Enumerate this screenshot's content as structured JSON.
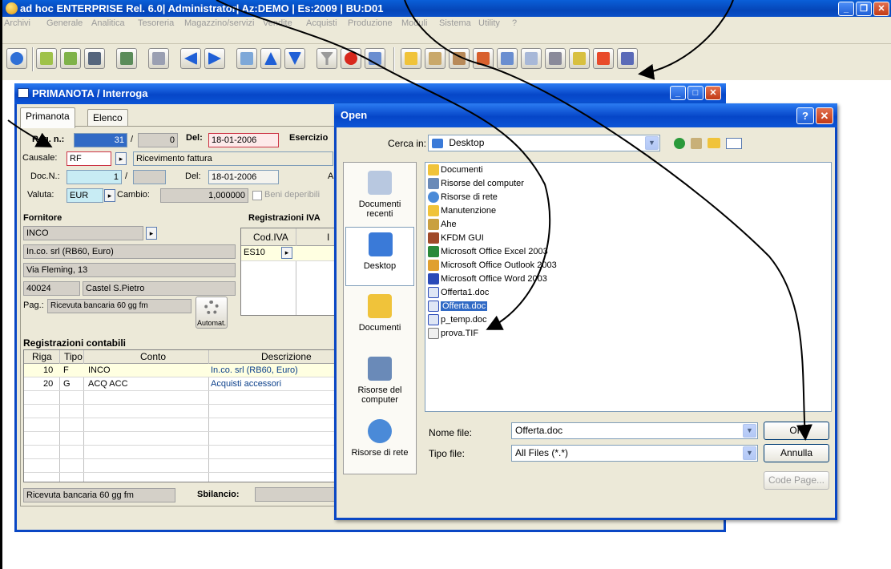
{
  "app": {
    "title": "ad hoc ENTERPRISE Rel. 6.0| Administrator| Az:DEMO | Es:2009 | BU:D01"
  },
  "menu": [
    "Archivi",
    "Generale",
    "Analitica",
    "Tesoreria",
    "Magazzino/servizi",
    "Vendite",
    "Acquisti",
    "Produzione",
    "Moduli",
    "Sistema",
    "Utility",
    "?"
  ],
  "primanota": {
    "title": "PRIMANOTA / Interroga",
    "tabs": [
      "Primanota",
      "Elenco"
    ],
    "reg_label": "Reg. n.:",
    "reg_num": "31",
    "reg_suffix": "0",
    "del_label": "Del:",
    "del_value": "18-01-2006",
    "esercizio_label": "Esercizio",
    "causale_label": "Causale:",
    "causale_code": "RF",
    "causale_desc": "Ricevimento fattura",
    "docn_label": "Doc.N.:",
    "docn_value": "1",
    "docn_del_label": "Del:",
    "docn_del_value": "18-01-2006",
    "ar_label": "A",
    "valuta_label": "Valuta:",
    "valuta_value": "EUR",
    "cambio_label": "Cambio:",
    "cambio_value": "1,000000",
    "beni_label": "Beni deperibili",
    "fornitore_label": "Fornitore",
    "fornitore_code": "INCO",
    "fornitore_name": "In.co. srl  (RB60, Euro)",
    "fornitore_addr": "Via Fleming, 13",
    "fornitore_cap": "40024",
    "fornitore_city": "Castel S.Pietro",
    "pag_label": "Pag.:",
    "pag_value": "Ricevuta bancaria 60 gg fm",
    "automat_label": "Automat.",
    "iva_title": "Registrazioni IVA",
    "iva_headers": [
      "Cod.IVA",
      "I"
    ],
    "iva_code": "ES10",
    "contabili_title": "Registrazioni contabili",
    "contabili_headers": [
      "Riga",
      "Tipo",
      "Conto",
      "Descrizione"
    ],
    "contabili_rows": [
      {
        "riga": "10",
        "tipo": "F",
        "conto": "INCO",
        "desc": "In.co. srl  (RB60, Euro)"
      },
      {
        "riga": "20",
        "tipo": "G",
        "conto": "ACQ ACC",
        "desc": "Acquisti accessori"
      }
    ],
    "footer_pag": "Ricevuta bancaria 60 gg fm",
    "sbilancio_label": "Sbilancio:"
  },
  "open_dialog": {
    "title": "Open",
    "help": "?",
    "cerca_label": "Cerca in:",
    "cerca_value": "Desktop",
    "places": [
      "Documenti recenti",
      "Desktop",
      "Documenti",
      "Risorse del computer",
      "Risorse di rete"
    ],
    "files": [
      "Documenti",
      "Risorse del computer",
      "Risorse di rete",
      "Manutenzione",
      "Ahe",
      "KFDM GUI",
      "Microsoft Office Excel 2003",
      "Microsoft Office Outlook 2003",
      "Microsoft Office Word 2003",
      "Offerta1.doc",
      "Offerta.doc",
      "p_temp.doc",
      "prova.TIF"
    ],
    "nome_label": "Nome file:",
    "nome_value": "Offerta.doc",
    "tipo_label": "Tipo file:",
    "tipo_value": "All Files (*.*)",
    "ok_label": "OK",
    "annulla_label": "Annulla",
    "codepage_label": "Code Page..."
  },
  "colors": {
    "titlebar": "#0a47c4",
    "selection": "#316ac5",
    "window_bg": "#ece9d8"
  }
}
